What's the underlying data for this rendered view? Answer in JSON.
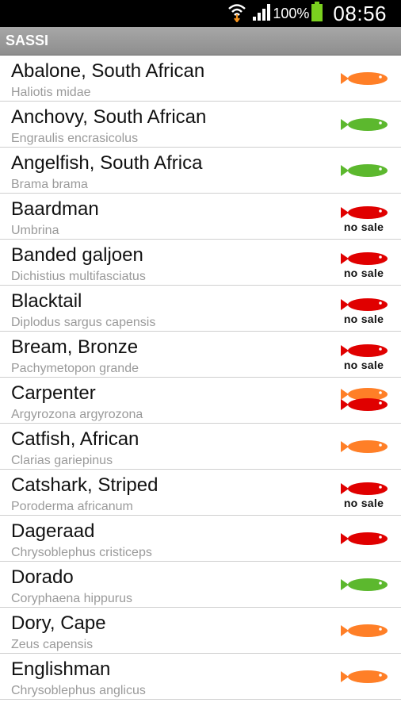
{
  "status_bar": {
    "battery_percent": "100%",
    "time": "08:56",
    "icons": [
      "wifi-icon",
      "signal-icon",
      "battery-icon"
    ]
  },
  "action_bar": {
    "title": "SASSI"
  },
  "colors": {
    "orange": "#ff7f27",
    "green": "#5cb82e",
    "red": "#e00000",
    "action_bar": "#9a9a9a"
  },
  "items": [
    {
      "name": "Abalone, South African",
      "scientific": "Haliotis midae",
      "status": "orange",
      "status_icon": "orange-fish-icon"
    },
    {
      "name": "Anchovy, South African",
      "scientific": "Engraulis encrasicolus",
      "status": "green",
      "status_icon": "green-fish-icon"
    },
    {
      "name": "Angelfish, South Africa",
      "scientific": "Brama brama",
      "status": "green",
      "status_icon": "green-fish-icon"
    },
    {
      "name": "Baardman",
      "scientific": "Umbrina",
      "status": "red-nosale",
      "status_icon": "red-fish-no-sale-icon",
      "badge": "no sale"
    },
    {
      "name": "Banded galjoen",
      "scientific": "Dichistius multifasciatus",
      "status": "red-nosale",
      "status_icon": "red-fish-no-sale-icon",
      "badge": "no sale"
    },
    {
      "name": "Blacktail",
      "scientific": "Diplodus sargus capensis",
      "status": "red-nosale",
      "status_icon": "red-fish-no-sale-icon",
      "badge": "no sale"
    },
    {
      "name": "Bream, Bronze",
      "scientific": "Pachymetopon grande",
      "status": "red-nosale",
      "status_icon": "red-fish-no-sale-icon",
      "badge": "no sale"
    },
    {
      "name": "Carpenter",
      "scientific": "Argyrozona argyrozona",
      "status": "orange-red",
      "status_icon": "orange-red-fish-icon"
    },
    {
      "name": "Catfish, African",
      "scientific": "Clarias gariepinus",
      "status": "orange",
      "status_icon": "orange-fish-icon"
    },
    {
      "name": "Catshark, Striped",
      "scientific": "Poroderma africanum",
      "status": "red-nosale",
      "status_icon": "red-fish-no-sale-icon",
      "badge": "no sale"
    },
    {
      "name": "Dageraad",
      "scientific": "Chrysoblephus cristiceps",
      "status": "red",
      "status_icon": "red-fish-icon"
    },
    {
      "name": "Dorado",
      "scientific": "Coryphaena hippurus",
      "status": "green",
      "status_icon": "green-fish-icon"
    },
    {
      "name": "Dory, Cape",
      "scientific": "Zeus capensis",
      "status": "orange",
      "status_icon": "orange-fish-icon"
    },
    {
      "name": "Englishman",
      "scientific": "Chrysoblephus anglicus",
      "status": "orange",
      "status_icon": "orange-fish-icon"
    }
  ]
}
